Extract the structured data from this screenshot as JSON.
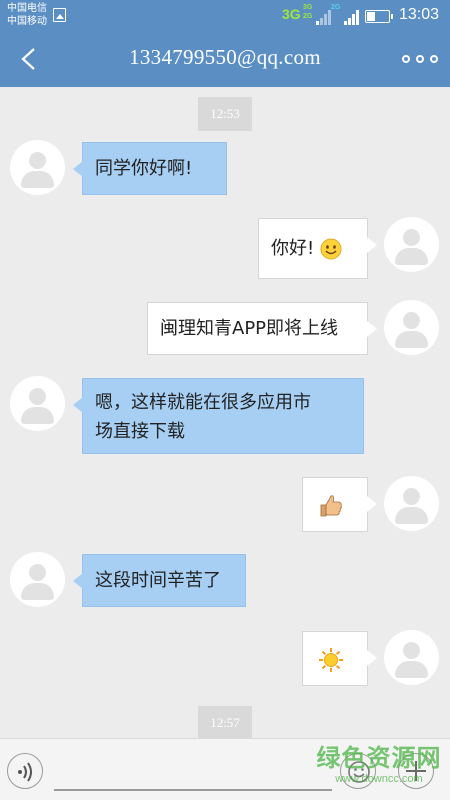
{
  "status_bar": {
    "carrier_1": "中国电信",
    "carrier_2": "中国移动",
    "network_type": "3G",
    "sim1_labels": [
      "3G",
      "2G"
    ],
    "sim2_label": "2G",
    "time": "13:03",
    "battery_level": 0.4
  },
  "header": {
    "title": "1334799550@qq.com",
    "back_icon": "back-chevron-icon",
    "more_icon": "more-dots-icon"
  },
  "messages": {
    "timestamp_1": "12:53",
    "m1": "同学你好啊!",
    "m2": "你好!",
    "m2_emoji": "smiley-face-icon",
    "m3": "闽理知青APP即将上线",
    "m4_line1": "嗯，这样就能在很多应用市",
    "m4_line2": "场直接下载",
    "m5_emoji": "thumbs-up-icon",
    "m6": "这段时间辛苦了",
    "m7_emoji": "sun-icon",
    "timestamp_2": "12:57"
  },
  "input_bar": {
    "placeholder": "",
    "voice_icon": "voice-icon",
    "emoji_icon": "smiley-icon",
    "plus_icon": "plus-icon"
  },
  "watermark": {
    "text": "绿色资源网",
    "url": "www.downcc.com"
  },
  "colors": {
    "header": "#5b8fc4",
    "incoming_bubble": "#a7cff4",
    "outgoing_bubble": "#ffffff",
    "background": "#ececec"
  }
}
